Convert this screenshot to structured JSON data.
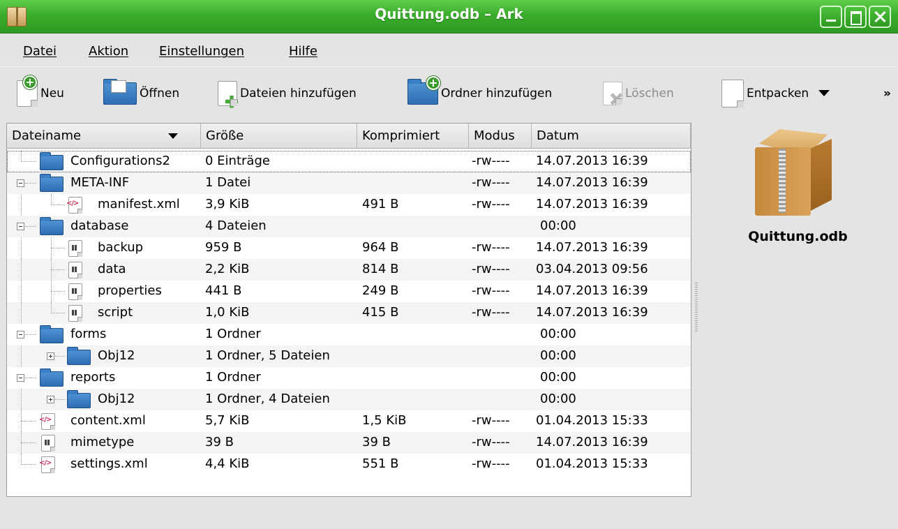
{
  "window": {
    "title": "Quittung.odb – Ark"
  },
  "menu": [
    "Datei",
    "Aktion",
    "Einstellungen",
    "Hilfe"
  ],
  "toolbar": {
    "neu": "Neu",
    "oeffnen": "Öffnen",
    "dateien_hinzufuegen": "Dateien hinzufügen",
    "ordner_hinzufuegen": "Ordner hinzufügen",
    "loeschen": "Löschen",
    "entpacken": "Entpacken",
    "overflow": "»"
  },
  "columns": {
    "name": "Dateiname",
    "size": "Größe",
    "compressed": "Komprimiert",
    "mode": "Modus",
    "date": "Datum"
  },
  "rows": [
    {
      "name": "Configurations2",
      "size": "0 Einträge",
      "compressed": "",
      "mode": "-rw----",
      "date": "14.07.2013 16:39"
    },
    {
      "name": "META-INF",
      "size": "1 Datei",
      "compressed": "",
      "mode": "-rw----",
      "date": "14.07.2013 16:39"
    },
    {
      "name": "manifest.xml",
      "size": "3,9 KiB",
      "compressed": "491 B",
      "mode": "-rw----",
      "date": "14.07.2013 16:39"
    },
    {
      "name": "database",
      "size": "4 Dateien",
      "compressed": "",
      "mode": "",
      "date": "00:00"
    },
    {
      "name": "backup",
      "size": "959 B",
      "compressed": "964 B",
      "mode": "-rw----",
      "date": "14.07.2013 16:39"
    },
    {
      "name": "data",
      "size": "2,2 KiB",
      "compressed": "814 B",
      "mode": "-rw----",
      "date": "03.04.2013 09:56"
    },
    {
      "name": "properties",
      "size": "441 B",
      "compressed": "249 B",
      "mode": "-rw----",
      "date": "14.07.2013 16:39"
    },
    {
      "name": "script",
      "size": "1,0 KiB",
      "compressed": "415 B",
      "mode": "-rw----",
      "date": "14.07.2013 16:39"
    },
    {
      "name": "forms",
      "size": "1 Ordner",
      "compressed": "",
      "mode": "",
      "date": "00:00"
    },
    {
      "name": "Obj12",
      "size": "1 Ordner, 5 Dateien",
      "compressed": "",
      "mode": "",
      "date": "00:00"
    },
    {
      "name": "reports",
      "size": "1 Ordner",
      "compressed": "",
      "mode": "",
      "date": "00:00"
    },
    {
      "name": "Obj12",
      "size": "1 Ordner, 4 Dateien",
      "compressed": "",
      "mode": "",
      "date": "00:00"
    },
    {
      "name": "content.xml",
      "size": "5,7 KiB",
      "compressed": "1,5 KiB",
      "mode": "-rw----",
      "date": "01.04.2013 15:33"
    },
    {
      "name": "mimetype",
      "size": "39 B",
      "compressed": "39 B",
      "mode": "-rw----",
      "date": "14.07.2013 16:39"
    },
    {
      "name": "settings.xml",
      "size": "4,4 KiB",
      "compressed": "551 B",
      "mode": "-rw----",
      "date": "01.04.2013 15:33"
    }
  ],
  "info_panel": {
    "filename": "Quittung.odb"
  }
}
